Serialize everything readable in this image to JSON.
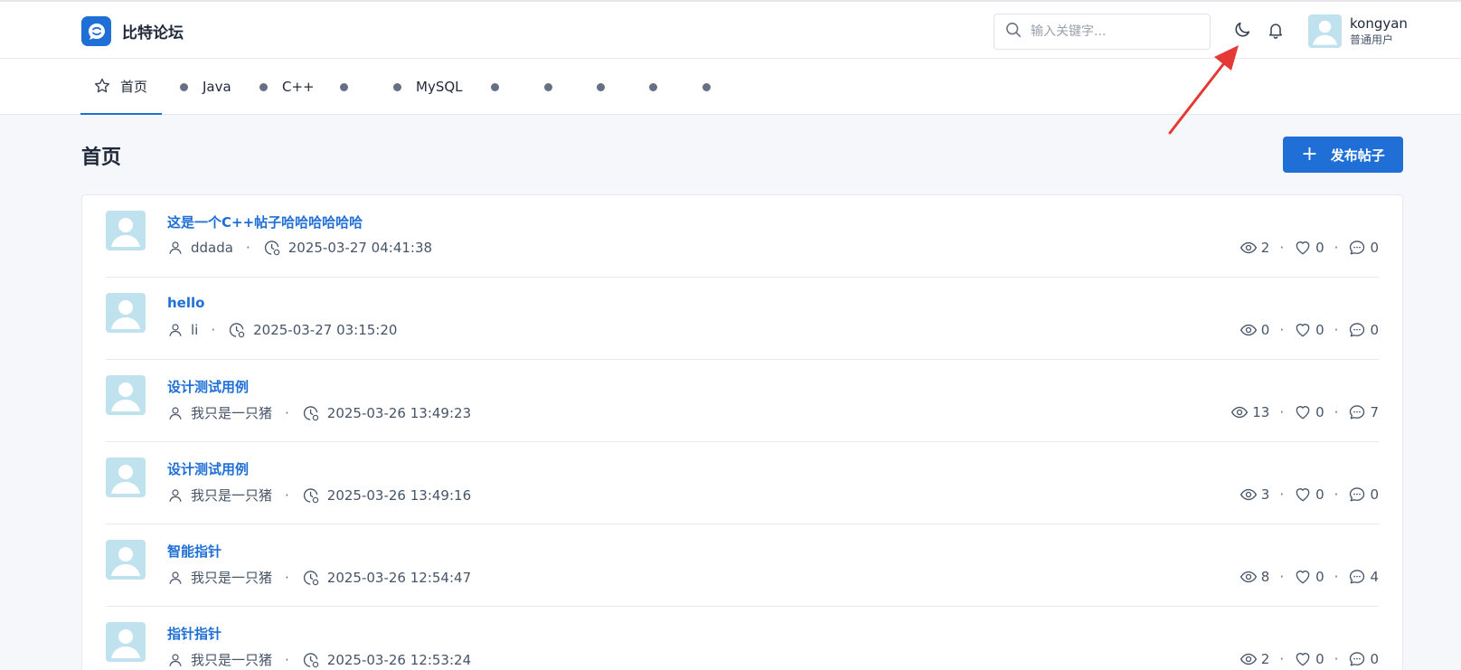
{
  "app": {
    "name": "比特论坛"
  },
  "search": {
    "placeholder": "输入关键字..."
  },
  "user": {
    "name": "kongyan",
    "role": "普通用户"
  },
  "tabs": [
    {
      "label": "首页",
      "active": true
    },
    {
      "label": "Java"
    },
    {
      "label": "C++"
    },
    {
      "label": ""
    },
    {
      "label": "MySQL"
    },
    {
      "label": ""
    },
    {
      "label": ""
    },
    {
      "label": ""
    },
    {
      "label": ""
    },
    {
      "label": ""
    }
  ],
  "page": {
    "title": "首页",
    "publish_label": "发布帖子"
  },
  "posts": [
    {
      "title": "这是一个C++帖子哈哈哈哈哈哈",
      "author": "ddada",
      "time": "2025-03-27 04:41:38",
      "views": "2",
      "likes": "0",
      "comments": "0"
    },
    {
      "title": "hello",
      "author": "li",
      "time": "2025-03-27 03:15:20",
      "views": "0",
      "likes": "0",
      "comments": "0"
    },
    {
      "title": "设计测试用例",
      "author": "我只是一只猪",
      "time": "2025-03-26 13:49:23",
      "views": "13",
      "likes": "0",
      "comments": "7"
    },
    {
      "title": "设计测试用例",
      "author": "我只是一只猪",
      "time": "2025-03-26 13:49:16",
      "views": "3",
      "likes": "0",
      "comments": "0"
    },
    {
      "title": "智能指针",
      "author": "我只是一只猪",
      "time": "2025-03-26 12:54:47",
      "views": "8",
      "likes": "0",
      "comments": "4"
    },
    {
      "title": "指针指针",
      "author": "我只是一只猪",
      "time": "2025-03-26 12:53:24",
      "views": "2",
      "likes": "0",
      "comments": "0"
    }
  ],
  "colors": {
    "accent": "#1f6fd6",
    "annotation_arrow": "#e53935"
  }
}
